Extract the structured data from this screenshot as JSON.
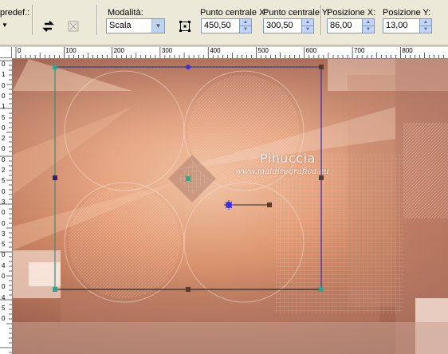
{
  "toolbar": {
    "preset_label": "predef.:",
    "mode": {
      "label": "Modalità:",
      "value": "Scala"
    },
    "center_x": {
      "label": "Punto centrale X:",
      "value": "450,50"
    },
    "center_y": {
      "label": "Punto centrale Y:",
      "value": "300,50"
    },
    "pos_x": {
      "label": "Posizione X:",
      "value": "86,00"
    },
    "pos_y": {
      "label": "Posizione Y:",
      "value": "13,00"
    }
  },
  "ruler": {
    "horizontal": [
      "0",
      "100",
      "200",
      "300",
      "400",
      "500",
      "600",
      "700",
      "800"
    ],
    "vertical": [
      "0",
      "1",
      "0",
      "0",
      "1",
      "5",
      "0",
      "2",
      "0",
      "0",
      "2",
      "5",
      "0",
      "3",
      "0",
      "0",
      "3",
      "5",
      "0",
      "4",
      "0",
      "0",
      "4",
      "5",
      "0"
    ]
  },
  "watermark": {
    "title": "Pinuccia",
    "site": "www.maidiregrafica.eu"
  },
  "colors": {
    "toolbar_bg": "#ece9d8",
    "handle_green": "#2fa58f",
    "handle_brown": "#5a3a28",
    "pick_blue": "#3a2ee8",
    "canvas_tone": "#d8906c"
  },
  "icons": [
    "dropdown-arrow-icon",
    "rotate-arrow-icon",
    "reset-transform-icon",
    "pick-tool-icon",
    "spin-up-icon",
    "spin-down-icon"
  ]
}
